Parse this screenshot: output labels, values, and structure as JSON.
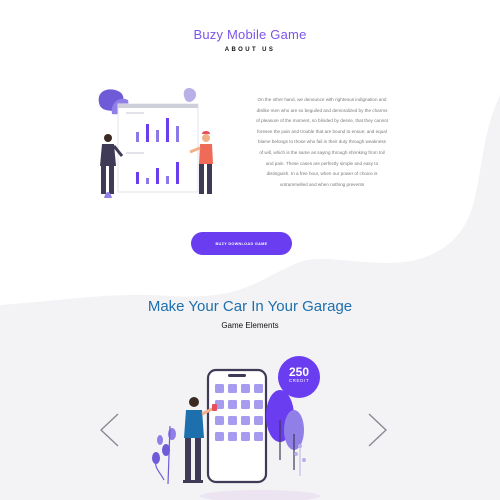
{
  "about": {
    "title": "Buzy Mobile Game",
    "subtitle": "ABOUT US",
    "paragraph_lines": [
      "On the other hand, we denounce with righteous indignation and",
      "dislike men who are so beguiled and demoralized by the charms",
      "of pleasure of the moment, so blinded by desire, that they cannot",
      "foresee the pain and trouble that are bound to ensue; and equal",
      "blame belongs to those who fail in their duty through weakness",
      "of will, which is the same as saying through shrinking from toil",
      "and pain. These cases are perfectly simple and easy to",
      "distinguish. In a free hour, when our power of choice is",
      "untrammelled and when nothing prevents"
    ],
    "cta_label": "BUZY DOWNLOAD GAME"
  },
  "game": {
    "title": "Make Your Car In Your Garage",
    "subtitle": "Game Elements",
    "badge_value": "250",
    "badge_caption": "CREDIT"
  },
  "colors": {
    "accent": "#6a3df0",
    "title_purple": "#7b56e6",
    "title_blue": "#1d6fae",
    "tile": "#a79bf0"
  },
  "icons": {
    "prev": "chevron-left-icon",
    "next": "chevron-right-icon"
  }
}
